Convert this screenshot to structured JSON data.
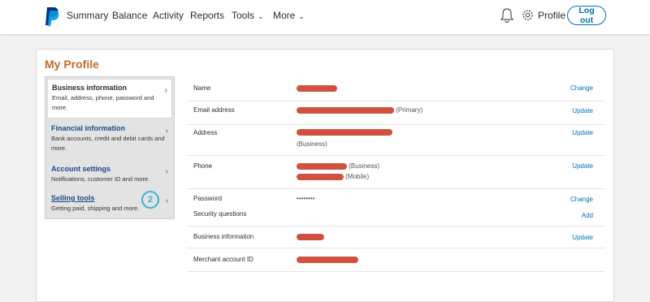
{
  "nav": {
    "items": [
      {
        "label": "Summary"
      },
      {
        "label": "Balance"
      },
      {
        "label": "Activity"
      },
      {
        "label": "Reports"
      },
      {
        "label": "Tools"
      },
      {
        "label": "More"
      }
    ],
    "profile_label": "Profile",
    "logout_label": "Log out"
  },
  "page": {
    "title": "My Profile"
  },
  "sidebar": {
    "items": [
      {
        "title": "Business information",
        "desc": "Email, address, phone, password and more."
      },
      {
        "title": "Financial information",
        "desc": "Bank accounts, credit and debit cards and more."
      },
      {
        "title": "Account settings",
        "desc": "Notifications, customer ID and more."
      },
      {
        "title": "Selling tools",
        "desc": "Getting paid, shipping and more."
      }
    ],
    "step_number": "2"
  },
  "details": {
    "name": {
      "label": "Name",
      "action": "Change"
    },
    "email": {
      "label": "Email address",
      "suffix": "(Primary)",
      "action": "Update"
    },
    "address": {
      "label": "Address",
      "note": "(Business)",
      "action": "Update"
    },
    "phone": {
      "label": "Phone",
      "note1": "(Business)",
      "note2": "(Mobile)",
      "action": "Update"
    },
    "password": {
      "label": "Password",
      "value": "••••••••",
      "action": "Change"
    },
    "security": {
      "label": "Security questions",
      "action": "Add"
    },
    "business": {
      "label": "Business information",
      "action": "Update"
    },
    "merchant": {
      "label": "Merchant account ID"
    }
  },
  "colors": {
    "accent_link": "#0070ba",
    "title_orange": "#c46b2b",
    "redaction": "#c9331f",
    "step_circle": "#3ab2d8"
  },
  "icons": [
    "paypal-logo-icon",
    "bell-icon",
    "gear-icon",
    "chevron-down-icon",
    "chevron-right-icon"
  ]
}
